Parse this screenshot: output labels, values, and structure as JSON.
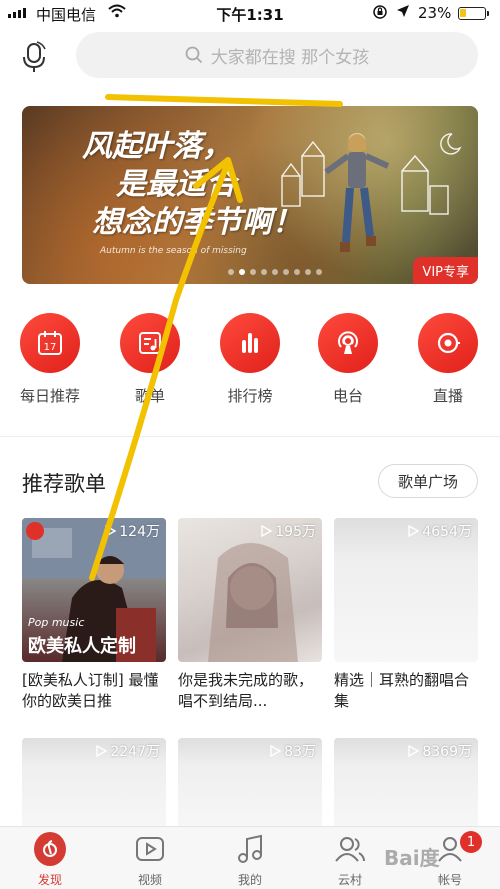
{
  "status_bar": {
    "carrier": "中国电信",
    "time": "下午1:31",
    "battery_percent": "23%",
    "battery_level": 0.23,
    "icons": [
      "signal-icon",
      "wifi-icon",
      "rotation-lock-icon",
      "location-icon",
      "battery-icon"
    ]
  },
  "header": {
    "mic_icon": "mic-icon",
    "search_placeholder": "大家都在搜 那个女孩",
    "search_icon": "search-icon"
  },
  "banner": {
    "headline": [
      "风起叶落，",
      "是最适合",
      "想念的季节啊！"
    ],
    "subline": "Autumn is the season of missing",
    "badge": "VIP专享",
    "dot_count": 9,
    "active_dot": 1
  },
  "nav": [
    {
      "label": "每日推荐",
      "icon": "calendar-icon",
      "icon_text": "17"
    },
    {
      "label": "歌单",
      "icon": "playlist-icon"
    },
    {
      "label": "排行榜",
      "icon": "chart-bars-icon"
    },
    {
      "label": "电台",
      "icon": "radio-icon"
    },
    {
      "label": "直播",
      "icon": "live-icon"
    }
  ],
  "section": {
    "title": "推荐歌单",
    "more_button": "歌单广场"
  },
  "playlists": [
    {
      "plays": "124万",
      "title": "[欧美私人订制] 最懂你的欧美日推",
      "cover_small": "Pop music",
      "cover_big": "欧美私人定制"
    },
    {
      "plays": "195万",
      "title": "你是我未完成的歌，唱不到结局..."
    },
    {
      "plays": "4654万",
      "title": "精选｜耳熟的翻唱合集"
    },
    {
      "plays": "2247万",
      "title": ""
    },
    {
      "plays": "83万",
      "title": ""
    },
    {
      "plays": "8369万",
      "title": ""
    }
  ],
  "tabbar": {
    "tabs": [
      {
        "label": "发现",
        "icon": "netease-music-icon",
        "active": true
      },
      {
        "label": "视频",
        "icon": "video-icon"
      },
      {
        "label": "我的",
        "icon": "music-note-icon"
      },
      {
        "label": "云村",
        "icon": "friends-icon"
      },
      {
        "label": "帐号",
        "icon": "account-icon",
        "badge": "1"
      }
    ]
  },
  "watermark": "Bai度",
  "colors": {
    "accent": "#e0302a",
    "search_bg": "#f1f1f1",
    "annotation": "#f2c100"
  }
}
